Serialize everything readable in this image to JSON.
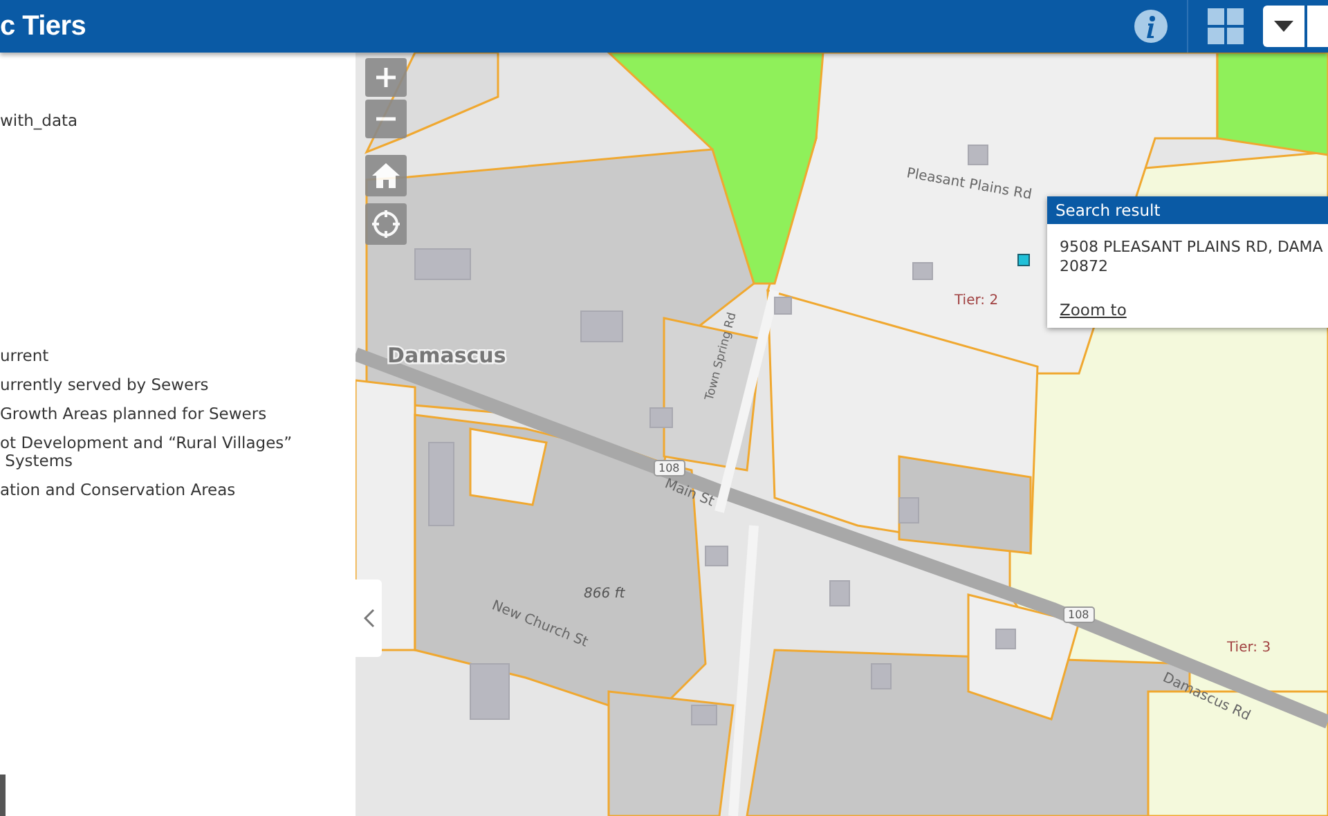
{
  "header": {
    "title": "c Tiers"
  },
  "legend": {
    "layer_name": "with_data",
    "items": [
      {
        "lines": [
          "urrent"
        ]
      },
      {
        "lines": [
          "urrently served by Sewers"
        ]
      },
      {
        "lines": [
          "Growth Areas planned for Sewers"
        ]
      },
      {
        "lines": [
          "ot Development and “Rural Villages”",
          " Systems"
        ]
      },
      {
        "lines": [
          "ation and Conservation Areas"
        ]
      }
    ]
  },
  "map": {
    "labels": [
      {
        "kind": "place",
        "text": "Damascus"
      },
      {
        "kind": "road",
        "text": "Main St"
      },
      {
        "kind": "road",
        "text": "New Church St"
      },
      {
        "kind": "road",
        "text": "Town Spring Rd"
      },
      {
        "kind": "road",
        "text": "Pleasant Plains Rd"
      },
      {
        "kind": "road",
        "text": "Damascus Rd"
      },
      {
        "kind": "tier",
        "text": "Tier: 2"
      },
      {
        "kind": "tier",
        "text": "Tier: 3"
      },
      {
        "kind": "elevation",
        "text": "866 ft"
      },
      {
        "kind": "shield",
        "text": "108"
      },
      {
        "kind": "shield",
        "text": "108"
      }
    ]
  },
  "popup": {
    "title": "Search result",
    "address_lines": [
      "9508 PLEASANT PLAINS RD, DAMA",
      "20872"
    ],
    "link": "Zoom to"
  }
}
